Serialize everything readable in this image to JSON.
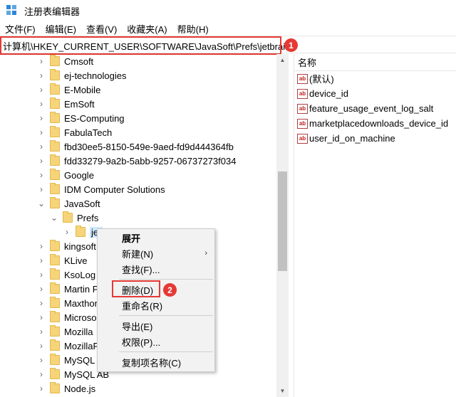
{
  "window": {
    "title": "注册表编辑器"
  },
  "menu": [
    "文件(F)",
    "编辑(E)",
    "查看(V)",
    "收藏夹(A)",
    "帮助(H)"
  ],
  "address": {
    "path": "计算机\\HKEY_CURRENT_USER\\SOFTWARE\\JavaSoft\\Prefs\\jetbrains",
    "step": "1"
  },
  "tree": [
    {
      "label": "Cmsoft"
    },
    {
      "label": "ej-technologies"
    },
    {
      "label": "E-Mobile"
    },
    {
      "label": "EmSoft"
    },
    {
      "label": "ES-Computing"
    },
    {
      "label": "FabulaTech"
    },
    {
      "label": "fbd30ee5-8150-549e-9aed-fd9d444364fb"
    },
    {
      "label": "fdd33279-9a2b-5abb-9257-06737273f034"
    },
    {
      "label": "Google"
    },
    {
      "label": "IDM Computer Solutions"
    },
    {
      "label": "JavaSoft"
    },
    {
      "label": "Prefs"
    },
    {
      "label": "jet"
    },
    {
      "label": "kingsoft"
    },
    {
      "label": "KLive"
    },
    {
      "label": "KsoLog"
    },
    {
      "label": "Martin P"
    },
    {
      "label": "Maxthon"
    },
    {
      "label": "Microso"
    },
    {
      "label": "Mozilla"
    },
    {
      "label": "MozillaP"
    },
    {
      "label": "MySQL"
    },
    {
      "label": "MySQL AB"
    },
    {
      "label": "Node.js"
    }
  ],
  "values": {
    "column_name": "名称",
    "items": [
      "(默认)",
      "device_id",
      "feature_usage_event_log_salt",
      "marketplacedownloads_device_id",
      "user_id_on_machine"
    ],
    "type_icon": "ab"
  },
  "context_menu": {
    "items": [
      "展开",
      "新建(N)",
      "查找(F)...",
      "删除(D)",
      "重命名(R)",
      "导出(E)",
      "权限(P)...",
      "复制项名称(C)"
    ],
    "step": "2"
  },
  "colors": {
    "highlight": "#e53935",
    "selection": "#cce8ff",
    "folder": "#f6d47a"
  }
}
